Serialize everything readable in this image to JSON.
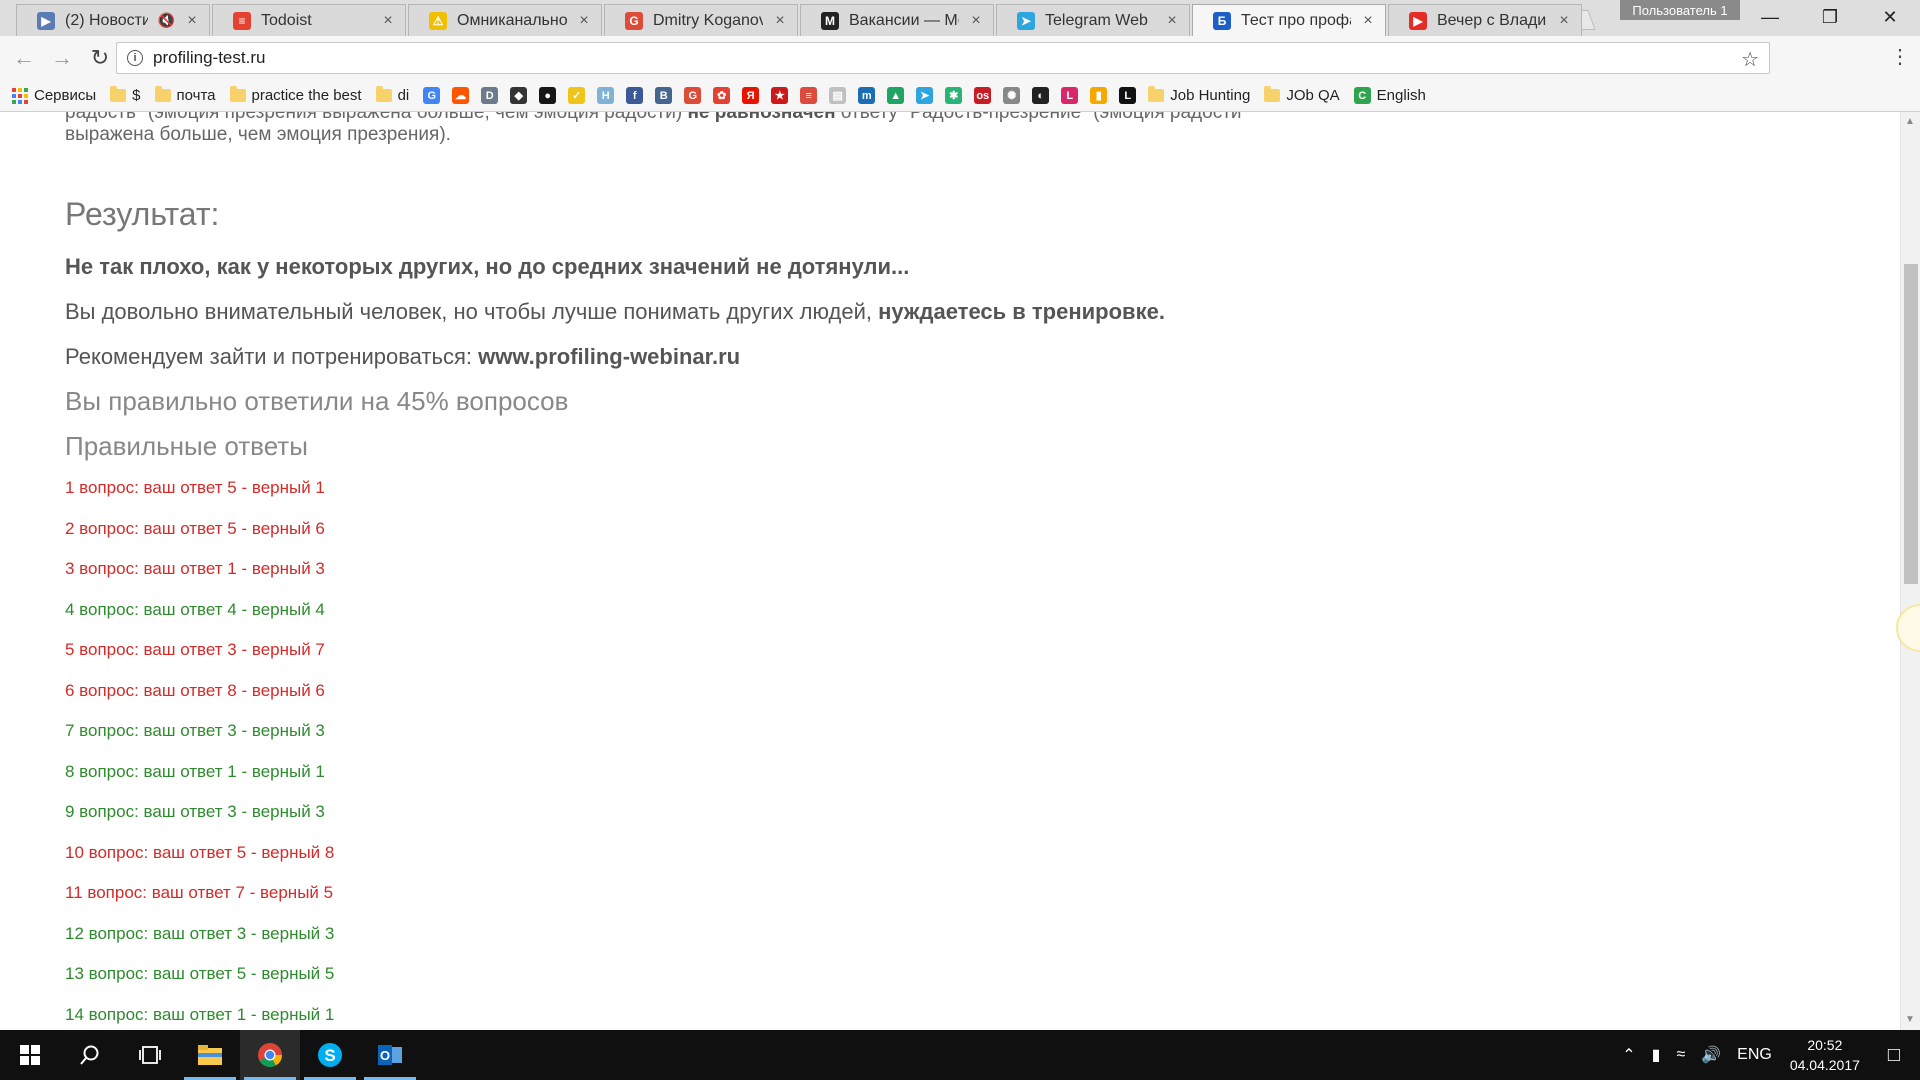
{
  "browser": {
    "tabs": [
      {
        "title": "(2) Новости",
        "fav_color": "#5b7bb4",
        "fav_char": "▶",
        "muted": true,
        "active": false
      },
      {
        "title": "Todoist",
        "fav_color": "#e44332",
        "fav_char": "≡",
        "muted": false,
        "active": false
      },
      {
        "title": "Омниканальность",
        "fav_color": "#f0c000",
        "fav_char": "⚠",
        "muted": false,
        "active": false
      },
      {
        "title": "Dmitry Koganovsky",
        "fav_color": "#dd4b39",
        "fav_char": "G",
        "muted": false,
        "active": false
      },
      {
        "title": "Вакансии — Мой",
        "fav_color": "#222222",
        "fav_char": "M",
        "muted": false,
        "active": false
      },
      {
        "title": "Telegram Web",
        "fav_color": "#2ca5e0",
        "fav_char": "➤",
        "muted": false,
        "active": false
      },
      {
        "title": "Тест про профай",
        "fav_color": "#1d5fc8",
        "fav_char": "Б",
        "muted": false,
        "active": true
      },
      {
        "title": "Вечер с Владими",
        "fav_color": "#e52d27",
        "fav_char": "▶",
        "muted": false,
        "active": false
      }
    ],
    "user_badge": "Пользователь 1",
    "address": "profiling-test.ru",
    "bookmarks": [
      {
        "label": "Сервисы",
        "kind": "apps"
      },
      {
        "label": "$",
        "kind": "folder"
      },
      {
        "label": "почта",
        "kind": "folder"
      },
      {
        "label": "practice the best",
        "kind": "folder"
      },
      {
        "label": "di",
        "kind": "folder"
      }
    ],
    "bookmark_icons": [
      {
        "color": "#4285f4",
        "char": "G"
      },
      {
        "color": "#ff5500",
        "char": "☁"
      },
      {
        "color": "#6b7b8b",
        "char": "D"
      },
      {
        "color": "#333333",
        "char": "◆"
      },
      {
        "color": "#181717",
        "char": "●"
      },
      {
        "color": "#f0c419",
        "char": "✓"
      },
      {
        "color": "#7fb2d6",
        "char": "H"
      },
      {
        "color": "#3b5998",
        "char": "f"
      },
      {
        "color": "#45668e",
        "char": "В"
      },
      {
        "color": "#dd4b39",
        "char": "G"
      },
      {
        "color": "#e34133",
        "char": "✿"
      },
      {
        "color": "#e61400",
        "char": "Я"
      },
      {
        "color": "#cc1a1a",
        "char": "★"
      },
      {
        "color": "#db4c3f",
        "char": "≡"
      },
      {
        "color": "#c0c0c0",
        "char": "▤"
      },
      {
        "color": "#1c6eb4",
        "char": "m"
      },
      {
        "color": "#1fa463",
        "char": "▲"
      },
      {
        "color": "#2ca5e0",
        "char": "➤"
      },
      {
        "color": "#29b473",
        "char": "✱"
      },
      {
        "color": "#c81d25",
        "char": "os"
      },
      {
        "color": "#888888",
        "char": "✺"
      },
      {
        "color": "#222222",
        "char": "◐"
      },
      {
        "color": "#d6286b",
        "char": "L"
      },
      {
        "color": "#f5a800",
        "char": "▮"
      },
      {
        "color": "#111111",
        "char": "L"
      }
    ],
    "bookmarks_tail": [
      {
        "label": "Job Hunting",
        "kind": "folder"
      },
      {
        "label": "JOb QA",
        "kind": "folder"
      },
      {
        "label": "English",
        "kind": "icon",
        "color": "#2ea44f",
        "char": "C"
      }
    ]
  },
  "page": {
    "intro_line1_a": "радость\" (эмоция презрения выражена больше, чем эмоция радости)",
    "intro_line1_b": "не равнозначен",
    "intro_line1_c": "ответу \"Радость-презрение\" (эмоция радости",
    "intro_line2": "выражена больше, чем эмоция презрения).",
    "result_title": "Результат:",
    "verdict": "Не так плохо, как у некоторых других, но до средних значений не дотянули...",
    "attention_a": "Вы довольно внимательный человек, но чтобы лучше понимать других людей,",
    "attention_b": "нуждаетесь в тренировке.",
    "recommend_a": "Рекомендуем зайти и потренироваться:",
    "recommend_b": "www.profiling-webinar.ru",
    "percent_line": "Вы правильно ответили на 45% вопросов",
    "answers_title": "Правильные ответы",
    "answers": [
      {
        "text": "1 вопрос: ваш ответ 5 - верный 1",
        "correct": false
      },
      {
        "text": "2 вопрос: ваш ответ 5 - верный 6",
        "correct": false
      },
      {
        "text": "3 вопрос: ваш ответ 1 - верный 3",
        "correct": false
      },
      {
        "text": "4 вопрос: ваш ответ 4 - верный 4",
        "correct": true
      },
      {
        "text": "5 вопрос: ваш ответ 3 - верный 7",
        "correct": false
      },
      {
        "text": "6 вопрос: ваш ответ 8 - верный 6",
        "correct": false
      },
      {
        "text": "7 вопрос: ваш ответ 3 - верный 3",
        "correct": true
      },
      {
        "text": "8 вопрос: ваш ответ 1 - верный 1",
        "correct": true
      },
      {
        "text": "9 вопрос: ваш ответ 3 - верный 3",
        "correct": true
      },
      {
        "text": "10 вопрос: ваш ответ 5 - верный 8",
        "correct": false
      },
      {
        "text": "11 вопрос: ваш ответ 7 - верный 5",
        "correct": false
      },
      {
        "text": "12 вопрос: ваш ответ 3 - верный 3",
        "correct": true
      },
      {
        "text": "13 вопрос: ваш ответ 5 - верный 5",
        "correct": true
      },
      {
        "text": "14 вопрос: ваш ответ 1 - верный 1",
        "correct": true
      }
    ]
  },
  "taskbar": {
    "language": "ENG",
    "time": "20:52",
    "date": "04.04.2017"
  }
}
